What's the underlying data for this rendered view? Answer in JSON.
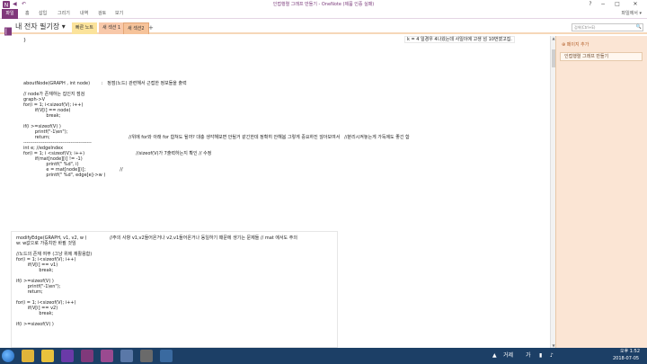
{
  "window": {
    "title": "인접행렬 그래프 만들기 - OneNote (제품 인증 실패)",
    "help": "?",
    "minimize": "−",
    "maximize": "□",
    "close": "✕"
  },
  "quick_access": {
    "back": "◀",
    "undo": "↶"
  },
  "ribbon": {
    "file_label": "파일",
    "tabs": [
      "홈",
      "삽입",
      "그리기",
      "내역",
      "검토",
      "보기"
    ],
    "right_label": "파일에서 ▾"
  },
  "notebook": {
    "title": "내 전자 필기장",
    "dropdown": "▾",
    "sections": [
      {
        "label": "빠른 노트",
        "color": "#fbe39b"
      },
      {
        "label": "새 섹션 1",
        "color": "#f8c8a9"
      },
      {
        "label": "새 섹션2",
        "color": "#f6c39a"
      }
    ],
    "add_section": "+",
    "search_placeholder": "검색(Ctrl+E)",
    "search_icon": "🔍"
  },
  "canvas": {
    "top_brace": "}",
    "note_top_right": "k = 4 일경우 4나왔는데 사일이에 고생 넘 10번였고집.",
    "block1": [
      {
        "text": "aboutNode(GRAPH , int node)        :   정점(노드) 관련해서 근접한 정보들을 출력",
        "color": "#222"
      },
      {
        "text": "",
        "color": "#222"
      },
      {
        "text": "// node가 존재하는 집인지 점검",
        "color": "#222"
      },
      {
        "text": "graph->V",
        "color": "#222"
      },
      {
        "text": "for(i = 1; i<sizeof(V); i++)",
        "color": "#222"
      },
      {
        "text": "        if(V[i] == node)",
        "color": "#222"
      },
      {
        "text": "                break;",
        "color": "#222"
      },
      {
        "text": "",
        "color": "#222"
      },
      {
        "text": "if(i >=sizeof(V) )",
        "color": "#222"
      },
      {
        "text": "        printf(\"-1\\en\");",
        "color": "#222"
      },
      {
        "text": "        return;                                                       //위에 for와 아래 for 합쳐도 될까? 대충 생각해보면 안될거 같긴한데 정확히 안해봄 그렇게 중요하진 않아보여서   //분리시켜놓는게 가독에도 좋긴 함",
        "color": "#222"
      },
      {
        "text": "------------------------------------------",
        "color": "#222"
      },
      {
        "text": "int e; //edgeIndex",
        "color": "#222"
      },
      {
        "text": "for(i = 1; i <sizeof(V); i++)                                    //sizeof(V)가 7출력하는지 확인 // 수정",
        "color": "#222"
      },
      {
        "text": "        if(mat[node][i] != -1)",
        "color": "#222"
      },
      {
        "text": "                printf(\" %d\", i)",
        "color": "#222"
      },
      {
        "text": "                e = mat[node][i];                        //",
        "color": "#222"
      },
      {
        "text": "                printf(\" %d\", edge[e]->w )",
        "color": "#222"
      }
    ],
    "block2": [
      {
        "text": "modifyEdge(GRAPH, v1, v2, w )                //주의 사항 v1,v2들어온거나 v2,v1들어온거나 동일하기 때문에 생기는 문제들 // mat 에서도 주의",
        "color": "#222"
      },
      {
        "text": "w: w값으로 가중치만 바뀔 것임",
        "color": "#222"
      },
      {
        "text": "",
        "color": "#222"
      },
      {
        "text": "//노드의 존재 여부 (그냥 위에 재활용함)",
        "color": "#222"
      },
      {
        "text": "for(i = 1; i<sizeof(V); i++)",
        "color": "#222"
      },
      {
        "text": "        if(V[i] == v1)",
        "color": "#222"
      },
      {
        "text": "                break;",
        "color": "#222"
      },
      {
        "text": "",
        "color": "#222"
      },
      {
        "text": "if(i >=sizeof(V) )",
        "color": "#222"
      },
      {
        "text": "        printf(\"-1\\en\");",
        "color": "#222"
      },
      {
        "text": "        return;",
        "color": "#222"
      },
      {
        "text": "",
        "color": "#222"
      },
      {
        "text": "for(i = 1; i<sizeof(V); i++)",
        "color": "#222"
      },
      {
        "text": "        if(V[i] == v2)",
        "color": "#222"
      },
      {
        "text": "                break;",
        "color": "#222"
      },
      {
        "text": "",
        "color": "#222"
      },
      {
        "text": "if(i >=sizeof(V) )",
        "color": "#222"
      }
    ]
  },
  "pages_panel": {
    "add_page": "⊕ 페이지 추가",
    "pages": [
      "인접행렬 그래프 만들기"
    ]
  },
  "taskbar": {
    "apps": [
      {
        "name": "chrome",
        "color": "#e0b43a"
      },
      {
        "name": "explorer",
        "color": "#e8c23d"
      },
      {
        "name": "visual-studio",
        "color": "#6a3aa8"
      },
      {
        "name": "onenote",
        "color": "#80397b"
      },
      {
        "name": "onenote-2",
        "color": "#9a4a90"
      },
      {
        "name": "app-6",
        "color": "#5a78a8"
      },
      {
        "name": "app-7",
        "color": "#6a6a6a"
      },
      {
        "name": "app-8",
        "color": "#3a6aa0"
      }
    ],
    "weather": "거제",
    "language": "가",
    "time": "오후 1:52",
    "date": "2018-07-05"
  }
}
